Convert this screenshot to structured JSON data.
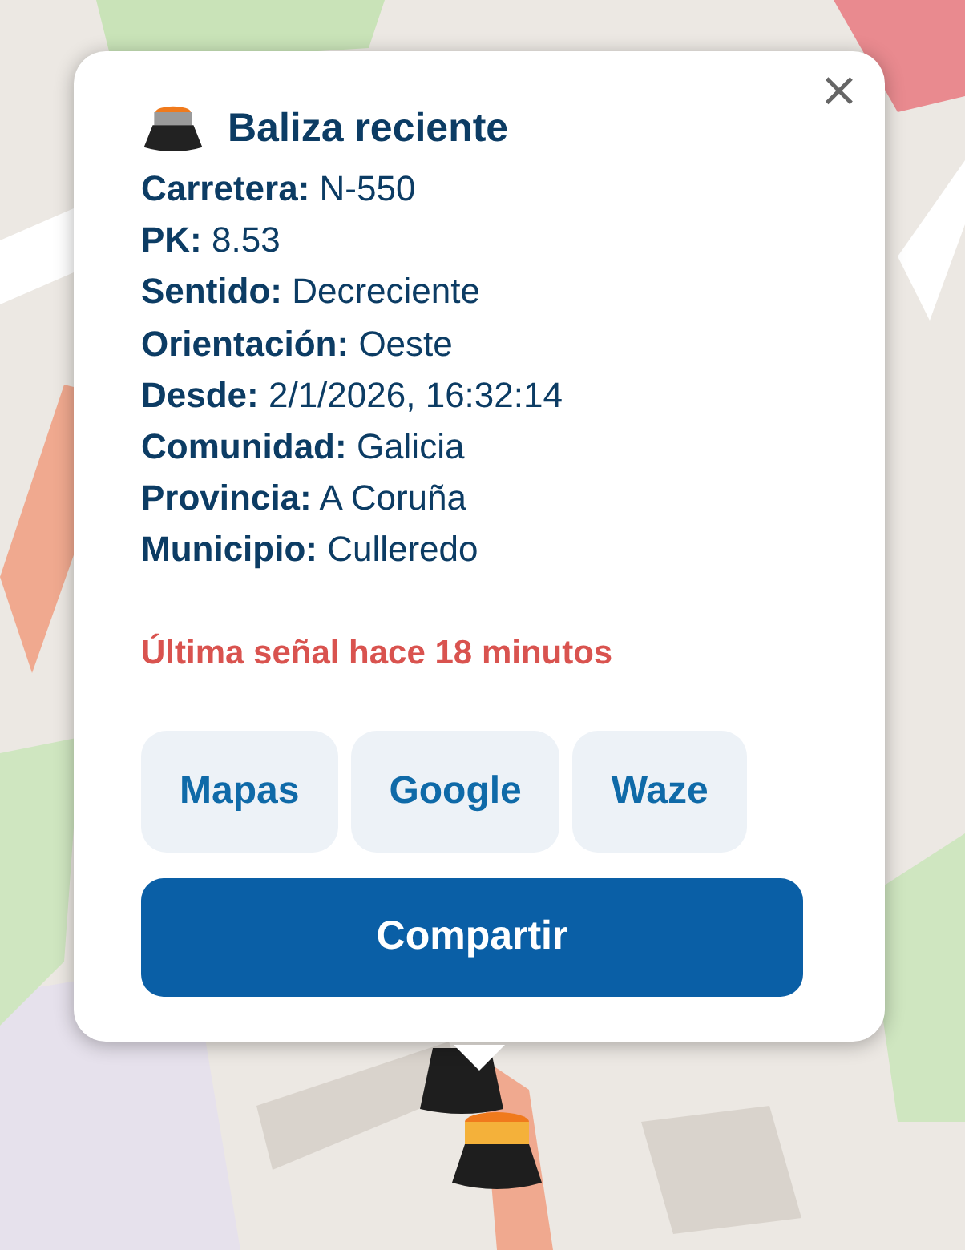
{
  "popup": {
    "close": "×",
    "title": "Baliza reciente",
    "fields": [
      {
        "label": "Carretera:",
        "value": "N-550"
      },
      {
        "label": "PK:",
        "value": "8.53"
      },
      {
        "label": "Sentido:",
        "value": "Decreciente"
      },
      {
        "label": "Orientación:",
        "value": "Oeste"
      },
      {
        "label": "Desde:",
        "value": "2/1/2026, 16:32:14"
      },
      {
        "label": "Comunidad:",
        "value": "Galicia"
      },
      {
        "label": "Provincia:",
        "value": "A Coruña"
      },
      {
        "label": "Municipio:",
        "value": "Culleredo"
      }
    ],
    "alert": "Última señal hace 18 minutos",
    "links": [
      "Mapas",
      "Google",
      "Waze"
    ],
    "share": "Compartir"
  }
}
